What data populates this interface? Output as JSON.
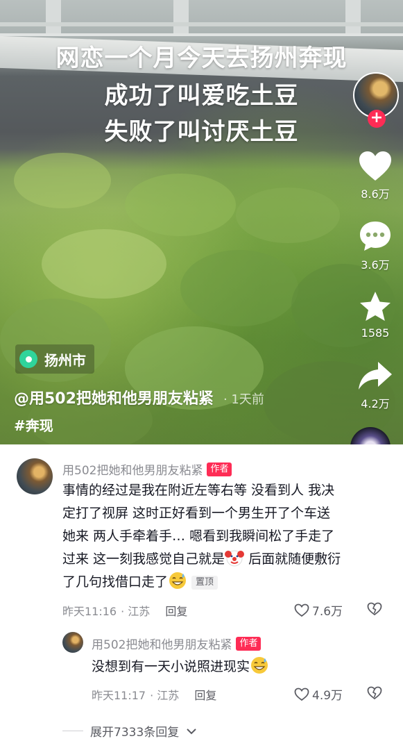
{
  "video": {
    "caption_lines": [
      "网恋一个月今天去扬州奔现",
      "成功了叫爱吃土豆",
      "失败了叫讨厌土豆"
    ],
    "location": "扬州市",
    "author": "@用502把她和他男朋友粘紧",
    "time": "· 1天前",
    "hashtag": "#奔现"
  },
  "actions": {
    "likes": "8.6万",
    "comments": "3.6万",
    "favorites": "1585",
    "shares": "4.2万",
    "follow_symbol": "+"
  },
  "comments": [
    {
      "user": "用502把她和他男朋友粘紧",
      "badge": "作者",
      "text_lines": [
        "事情的经过是我在附近左等右等 没看到人 我决",
        "定打了视屏 这时正好看到一个男生开了个车送",
        "她来 两人手牵着手… 嗯看到我瞬间松了手走了",
        "过来 这一刻我感觉自己就是",
        " 后面就随便敷衍",
        "了几句找借口走了"
      ],
      "pin_label": "置顶",
      "time": "昨天11:16",
      "region": "· 江苏",
      "reply_label": "回复",
      "likes": "7.6万"
    },
    {
      "user": "用502把她和他男朋友粘紧",
      "badge": "作者",
      "text": "没想到有一天小说照进现实",
      "time": "昨天11:17",
      "region": "· 江苏",
      "reply_label": "回复",
      "likes": "4.9万"
    }
  ],
  "expand_label": "展开7333条回复",
  "icons": {
    "like": "heart-icon",
    "comment": "comment-bubble-icon",
    "favorite": "star-icon",
    "share": "share-arrow-icon",
    "location": "location-pin-icon",
    "comment_like": "heart-outline-icon",
    "comment_dislike": "broken-heart-icon",
    "clown": "clown-emoji-icon",
    "sweat": "sweat-smile-emoji-icon",
    "chevron": "chevron-down-icon"
  },
  "colors": {
    "accent": "#fe2c55",
    "location_pin": "#2fd49b",
    "meta_text": "#8a8b91"
  }
}
